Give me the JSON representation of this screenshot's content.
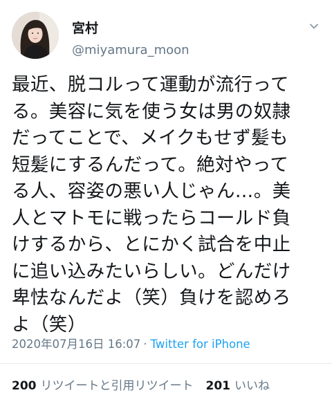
{
  "tweet": {
    "author": {
      "name": "宮村",
      "handle": "@miyamura_moon"
    },
    "text_lines": [
      "最近、脱コルって運動が流行って",
      "る。美容に気を使う女は男の奴隷",
      "だってことで、メイクもせず髪も",
      "短髪にするんだって。絶対やって",
      "る人、容姿の悪い人じゃん…。美",
      "人とマトモに戦ったらコールド負",
      "けするから、とにかく試合を中止",
      "に追い込みたいらしい。どんだけ",
      "卑怯なんだよ（笑）負けを認めろ",
      "よ（笑）"
    ],
    "timestamp": "2020年07月16日 16:07",
    "separator": "·",
    "source": "Twitter for iPhone",
    "stats": {
      "retweets_count": "200",
      "retweets_label": "リツイートと引用リツイート",
      "likes_count": "201",
      "likes_label": "いいね"
    }
  },
  "icons": {
    "menu": "chevron-down-icon",
    "avatar": "avatar"
  },
  "colors": {
    "text": "#14171a",
    "secondary": "#657786",
    "link": "#1da1f2",
    "divider": "#e6ecf0"
  }
}
